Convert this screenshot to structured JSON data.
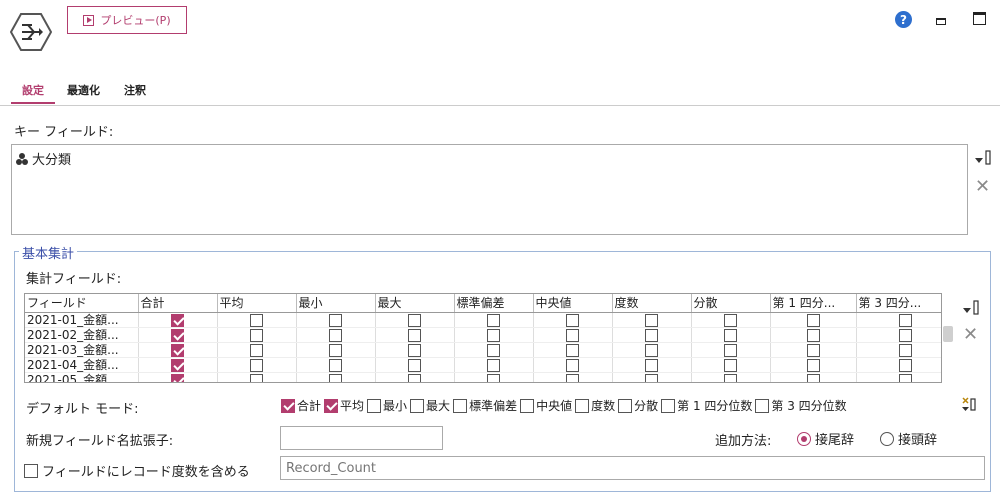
{
  "header": {
    "preview_label": "プレビュー(P)",
    "help_symbol": "?"
  },
  "tabs": [
    {
      "label": "設定",
      "active": true
    },
    {
      "label": "最適化",
      "active": false
    },
    {
      "label": "注釈",
      "active": false
    }
  ],
  "key_fields": {
    "label": "キー フィールド:",
    "items": [
      "大分類"
    ]
  },
  "basic_aggregation": {
    "title": "基本集計",
    "agg_fields_label": "集計フィールド:",
    "columns": [
      "フィールド",
      "合計",
      "平均",
      "最小",
      "最大",
      "標準偏差",
      "中央値",
      "度数",
      "分散",
      "第 1 四分...",
      "第 3 四分..."
    ],
    "rows": [
      {
        "field": "2021-01_金額...",
        "checks": [
          true,
          false,
          false,
          false,
          false,
          false,
          false,
          false,
          false,
          false
        ]
      },
      {
        "field": "2021-02_金額...",
        "checks": [
          true,
          false,
          false,
          false,
          false,
          false,
          false,
          false,
          false,
          false
        ]
      },
      {
        "field": "2021-03_金額...",
        "checks": [
          true,
          false,
          false,
          false,
          false,
          false,
          false,
          false,
          false,
          false
        ]
      },
      {
        "field": "2021-04_金額...",
        "checks": [
          true,
          false,
          false,
          false,
          false,
          false,
          false,
          false,
          false,
          false
        ]
      },
      {
        "field": "2021-05_金額...",
        "checks": [
          true,
          false,
          false,
          false,
          false,
          false,
          false,
          false,
          false,
          false
        ]
      }
    ],
    "default_mode": {
      "label": "デフォルト モード:",
      "options": [
        {
          "label": "合計",
          "checked": true
        },
        {
          "label": "平均",
          "checked": true
        },
        {
          "label": "最小",
          "checked": false
        },
        {
          "label": "最大",
          "checked": false
        },
        {
          "label": "標準偏差",
          "checked": false
        },
        {
          "label": "中央値",
          "checked": false
        },
        {
          "label": "度数",
          "checked": false
        },
        {
          "label": "分散",
          "checked": false
        },
        {
          "label": "第 1 四分位数",
          "checked": false
        },
        {
          "label": "第 3 四分位数",
          "checked": false
        }
      ]
    },
    "new_field_suffix": {
      "label": "新規フィールド名拡張子:",
      "value": ""
    },
    "append_method": {
      "label": "追加方法:",
      "options": [
        {
          "label": "接尾辞",
          "selected": true
        },
        {
          "label": "接頭辞",
          "selected": false
        }
      ]
    },
    "record_count": {
      "label": "フィールドにレコード度数を含める",
      "checked": false,
      "placeholder": "Record_Count"
    }
  },
  "colors": {
    "accent": "#b23d6e",
    "group_border": "#9eb6d8",
    "group_title": "#3b4fa8",
    "help": "#2e6fce"
  }
}
